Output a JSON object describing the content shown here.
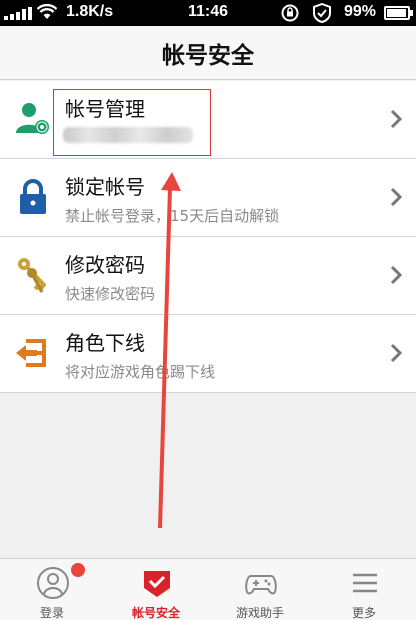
{
  "status_bar": {
    "speed": "1.8K/s",
    "time": "11:46",
    "battery": "99%"
  },
  "header": {
    "title": "帐号安全"
  },
  "rows": [
    {
      "title": "帐号管理",
      "subtitle": "",
      "icon": "user-gear-icon"
    },
    {
      "title": "锁定帐号",
      "subtitle": "禁止帐号登录，15天后自动解锁",
      "icon": "lock-icon"
    },
    {
      "title": "修改密码",
      "subtitle": "快速修改密码",
      "icon": "keys-icon"
    },
    {
      "title": "角色下线",
      "subtitle": "将对应游戏角色踢下线",
      "icon": "exit-icon"
    }
  ],
  "tabs": [
    {
      "label": "登录",
      "icon": "user-circle-icon",
      "active": false
    },
    {
      "label": "帐号安全",
      "icon": "shield-check-icon",
      "active": true
    },
    {
      "label": "游戏助手",
      "icon": "gamepad-icon",
      "active": false
    },
    {
      "label": "更多",
      "icon": "menu-icon",
      "active": false
    }
  ],
  "colors": {
    "accent": "#d8232a",
    "green": "#1e9e6a",
    "blue": "#1f5fa8",
    "gold": "#c8a23a",
    "orange": "#e07a1f"
  }
}
